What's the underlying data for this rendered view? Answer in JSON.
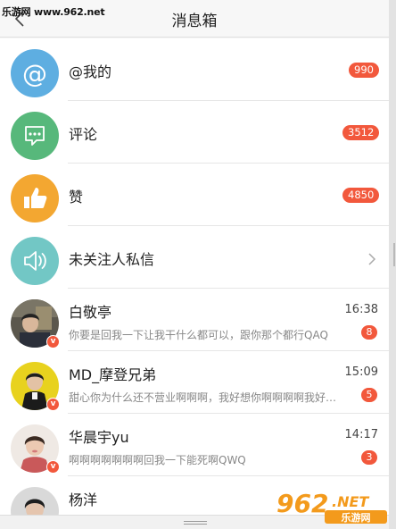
{
  "header": {
    "title": "消息箱",
    "watermark": "乐游网 www.962.net"
  },
  "notifications": [
    {
      "label": "@我的",
      "count": "990",
      "icon": "at-icon",
      "color": "#5eaee1"
    },
    {
      "label": "评论",
      "count": "3512",
      "icon": "comment-bubble-icon",
      "color": "#57b87b"
    },
    {
      "label": "赞",
      "count": "4850",
      "icon": "thumbs-up-icon",
      "color": "#f3a731"
    },
    {
      "label": "未关注人私信",
      "icon": "speaker-icon",
      "color": "#72c7c5",
      "has_chevron": true
    }
  ],
  "chats": [
    {
      "name": "白敬亭",
      "time": "16:38",
      "preview": "你要是回我一下让我干什么都可以，跟你那个都行QAQ",
      "unread": "8",
      "verified": "v"
    },
    {
      "name": "MD_摩登兄弟",
      "time": "15:09",
      "preview": "甜心你为什么还不营业啊啊啊，我好想你啊啊啊啊我好想你啊啊",
      "unread": "5",
      "verified": "v"
    },
    {
      "name": "华晨宇yu",
      "time": "14:17",
      "preview": "啊啊啊啊啊啊啊回我一下能死啊QWQ",
      "unread": "3",
      "verified": "v"
    },
    {
      "name": "杨洋",
      "verified": "v"
    }
  ],
  "logo": {
    "text": "962",
    "suffix": ".NET",
    "subtext": "乐游网"
  },
  "colors": {
    "badge": "#f2583c",
    "accent_orange": "#f39a1c"
  }
}
